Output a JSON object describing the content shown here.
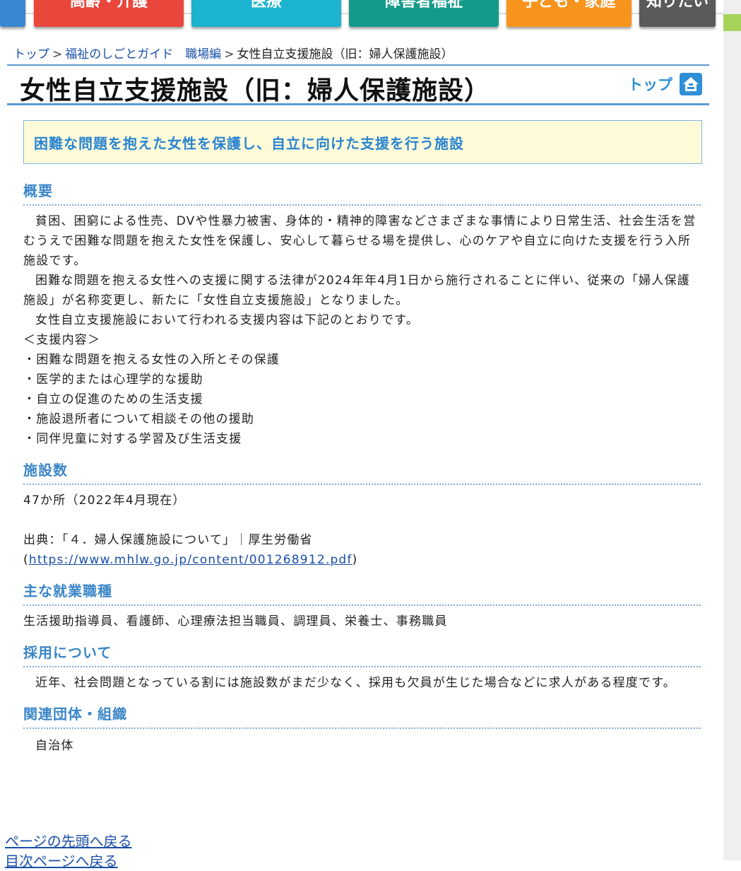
{
  "nav": {
    "tabs": [
      {
        "label": "",
        "color": "#3a86d0"
      },
      {
        "label": "高齢・介護",
        "color": "#e9473c"
      },
      {
        "label": "医療",
        "color": "#1bb3cf"
      },
      {
        "label": "障害者福祉",
        "color": "#149a8a"
      },
      {
        "label": "子ども・家庭",
        "color": "#f7941d"
      },
      {
        "label": "知りたい",
        "color": "#5a5a5a"
      }
    ]
  },
  "breadcrumb": {
    "top": "トップ",
    "guide": "福祉のしごとガイド　職場編",
    "sep": ">",
    "current": "女性自立支援施設（旧：婦人保護施設）"
  },
  "title": "女性自立支援施設（旧：婦人保護施設）",
  "top_link_label": "トップ",
  "lead": "困難な問題を抱えた女性を保護し、自立に向けた支援を行う施設",
  "sections": {
    "overview": {
      "heading": "概要",
      "p1": "貧困、困窮による性売、DVや性暴力被害、身体的・精神的障害などさまざまな事情により日常生活、社会生活を営むうえで困難な問題を抱えた女性を保護し、安心して暮らせる場を提供し、心のケアや自立に向けた支援を行う入所施設です。",
      "p2": "困難な問題を抱える女性への支援に関する法律が2024年年4月1日から施行されることに伴い、従来の「婦人保護施設」が名称変更し、新たに「女性自立支援施設」となりました。",
      "p3": "女性自立支援施設において行われる支援内容は下記のとおりです。",
      "list_title": "＜支援内容＞",
      "items": [
        "・困難な問題を抱える女性の入所とその保護",
        "・医学的または心理学的な援助",
        "・自立の促進のための生活支援",
        "・施設退所者について相談その他の援助",
        "・同伴児童に対する学習及び生活支援"
      ]
    },
    "count": {
      "heading": "施設数",
      "value": "47か所（2022年4月現在）",
      "source_text": "出典：「４．婦人保護施設について」｜厚生労働省",
      "source_open": "(",
      "source_url": "https://www.mhlw.go.jp/content/001268912.pdf",
      "source_close": ")"
    },
    "jobs": {
      "heading": "主な就業職種",
      "text": "生活援助指導員、看護師、心理療法担当職員、調理員、栄養士、事務職員"
    },
    "hiring": {
      "heading": "採用について",
      "text": "近年、社会問題となっている割には施設数がまだ少なく、採用も欠員が生じた場合などに求人がある程度です。"
    },
    "orgs": {
      "heading": "関連団体・組織",
      "text": "自治体"
    }
  },
  "bottom": {
    "back_to_top": "ページの先頭へ戻る",
    "back_to_index": "目次ページへ戻る"
  }
}
